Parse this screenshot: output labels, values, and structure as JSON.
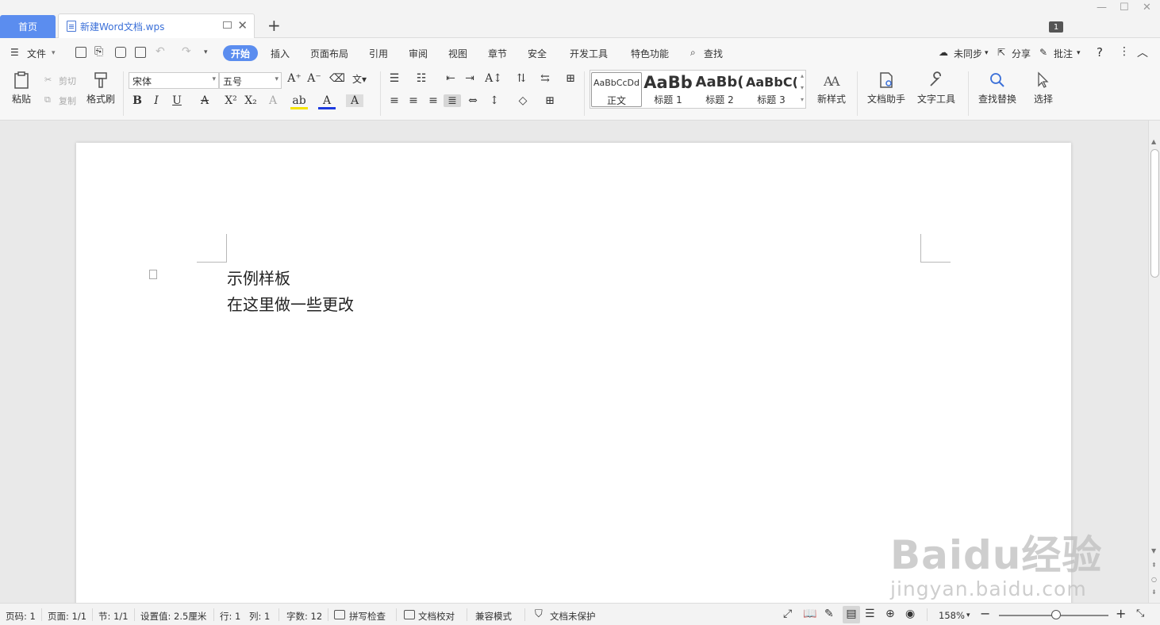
{
  "tabs": {
    "home": "首页",
    "doc_title": "新建Word文档.wps",
    "add": "+"
  },
  "window": {
    "badge": "1"
  },
  "menu": {
    "file": "文件",
    "items": [
      "开始",
      "插入",
      "页面布局",
      "引用",
      "审阅",
      "视图",
      "章节",
      "安全",
      "开发工具",
      "特色功能"
    ],
    "search": "查找",
    "right": {
      "sync": "未同步",
      "share": "分享",
      "comment": "批注",
      "help": "?"
    }
  },
  "ribbon": {
    "paste": "粘贴",
    "cut": "剪切",
    "copy": "复制",
    "format_painter": "格式刷",
    "font_name": "宋体",
    "font_size": "五号",
    "styles": [
      {
        "sample": "AaBbCcDd",
        "name": "正文"
      },
      {
        "sample": "AaBb",
        "name": "标题 1"
      },
      {
        "sample": "AaBb(",
        "name": "标题 2"
      },
      {
        "sample": "AaBbC(",
        "name": "标题 3"
      }
    ],
    "new_style": "新样式",
    "doc_assistant": "文档助手",
    "text_tools": "文字工具",
    "find_replace": "查找替换",
    "select": "选择"
  },
  "document": {
    "lines": [
      "示例样板",
      "在这里做一些更改"
    ]
  },
  "status": {
    "page_code": "页码: 1",
    "page": "页面: 1/1",
    "section": "节: 1/1",
    "setting": "设置值: 2.5厘米",
    "row": "行: 1",
    "col": "列: 1",
    "word_count": "字数: 12",
    "spell_check": "拼写检查",
    "doc_proof": "文档校对",
    "compat_mode": "兼容模式",
    "unprotected": "文档未保护",
    "zoom": "158%",
    "zoom_level": 0.52
  },
  "watermark": {
    "line1": "Baidu经验",
    "line2": "jingyan.baidu.com"
  },
  "colors": {
    "accent": "#5b8def",
    "tab_text": "#3a6fd8"
  }
}
